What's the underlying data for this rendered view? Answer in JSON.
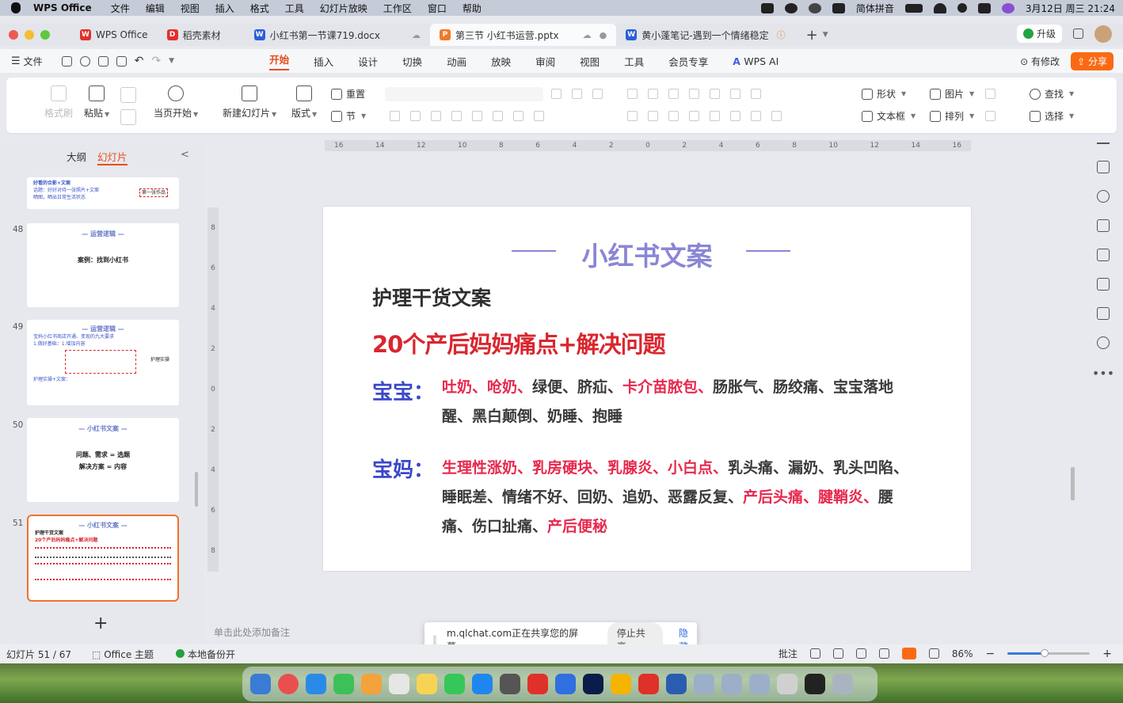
{
  "menubar": {
    "app": "WPS Office",
    "items": [
      "文件",
      "编辑",
      "视图",
      "插入",
      "格式",
      "工具",
      "幻灯片放映",
      "工作区",
      "窗口",
      "帮助"
    ],
    "ime": "简体拼音",
    "datetime": "3月12日 周三 21:24"
  },
  "tabs": [
    {
      "label": "WPS Office",
      "icon_color": "#e0302a",
      "logo": "W"
    },
    {
      "label": "稻壳素材",
      "icon_color": "#e0302a",
      "logo": "D"
    },
    {
      "label": "小红书第一节课719.docx",
      "icon_color": "#2b5fd9",
      "logo": "W"
    },
    {
      "label": "第三节 小红书运营.pptx",
      "icon_color": "#f07a27",
      "logo": "P",
      "active": true
    },
    {
      "label": "黄小蓬笔记-遇到一个情绪稳定",
      "icon_color": "#2b5fd9",
      "logo": "W"
    }
  ],
  "tabbar": {
    "upgrade": "升级"
  },
  "menurow": {
    "file": "文件",
    "tabs": [
      "开始",
      "插入",
      "设计",
      "切换",
      "动画",
      "放映",
      "审阅",
      "视图",
      "工具",
      "会员专享"
    ],
    "active": "开始",
    "ai": "WPS AI",
    "modified": "有修改",
    "share": "分享"
  },
  "ribbon": {
    "format_brush": "格式刷",
    "paste": "粘贴",
    "from_current": "当页开始",
    "new_slide": "新建幻灯片",
    "layout": "版式",
    "reset": "重置",
    "section": "节",
    "shape": "形状",
    "picture": "图片",
    "textbox": "文本框",
    "arrange": "排列",
    "find": "查找",
    "select": "选择"
  },
  "panel": {
    "outline": "大纲",
    "slides": "幻灯片",
    "collapse": "<",
    "add": "+"
  },
  "thumbs": [
    {
      "num": "",
      "title": "好看的合影+文案",
      "lines": [
        "话题：好好对待一张照片+文案",
        "晒图，晒出日常生活状态"
      ],
      "tag": "第一张作品"
    },
    {
      "num": "48",
      "title": "— 运营逻辑 —",
      "body": "案例：找到小红书"
    },
    {
      "num": "49",
      "title": "— 运营逻辑 —",
      "lines": [
        "宝妈小红书商店开通、变现的九大要求",
        "1.做好基础：1.增加内容",
        "护理实操+文案："
      ],
      "tag": "护理实操"
    },
    {
      "num": "50",
      "title": "— 小红书文案 —",
      "body": "问题、需求 = 选题",
      "body2": "解决方案 = 内容"
    },
    {
      "num": "51",
      "title": "— 小红书文案 —",
      "lines": [
        "护理干货文案",
        "20个产后妈妈痛点+解决问题"
      ],
      "selected": true
    }
  ],
  "ruler": {
    "h": [
      "16",
      "14",
      "12",
      "10",
      "8",
      "6",
      "4",
      "2",
      "0",
      "2",
      "4",
      "6",
      "8",
      "10",
      "12",
      "14",
      "16"
    ],
    "v": [
      "8",
      "6",
      "4",
      "2",
      "0",
      "2",
      "4",
      "6",
      "8"
    ]
  },
  "slide": {
    "title": "小红书文案",
    "subtitle": "护理干货文案",
    "headline": "20个产后妈妈痛点+解决问题",
    "baby": {
      "label": "宝宝：",
      "red1": "吐奶、呛奶、",
      "n1": "绿便、脐疝、",
      "red2": "卡介苗脓包、",
      "n2": "肠胀气、肠绞痛、宝宝落地醒、黑白颠倒、奶睡、抱睡"
    },
    "mom": {
      "label": "宝妈：",
      "red1": "生理性涨奶、乳房硬块、乳腺炎、小白点、",
      "n1": "乳头痛、漏奶、乳头凹陷、睡眠差、情绪不好、回奶、追奶、恶露反复、",
      "red2": "产后头痛、腱鞘炎、",
      "n2": "腰痛、伤口扯痛、",
      "red3": "产后便秘"
    }
  },
  "notes": "单击此处添加备注",
  "share_popup": {
    "text": "m.qlchat.com正在共享您的屏幕。",
    "stop": "停止共享",
    "hide": "隐藏"
  },
  "status": {
    "slide_count": "幻灯片 51 / 67",
    "theme": "Office 主题",
    "backup": "本地备份开",
    "comments": "批注",
    "zoom": "86%",
    "zoom_level": 0.45
  },
  "colors": {
    "accent": "#e84c1d",
    "share": "#fa6a14",
    "title": "#8a86d4",
    "red": "#d9262e",
    "pink": "#e8284d",
    "blue": "#3a48c8"
  },
  "dock_colors": [
    "#3a7bd5",
    "#e94f4f",
    "#2b8ae8",
    "#3cc15a",
    "#f3a23c",
    "#e6e6e6",
    "#f7d354",
    "#35c759",
    "#1f86f0",
    "#555555",
    "#e0302a",
    "#2f6fe0",
    "#0a1d4a",
    "#f4b400",
    "#e0302a",
    "#2a5db0",
    "#9bb0c8",
    "#9bb0c8",
    "#9bb0c8",
    "#d0d0d0",
    "#222222",
    "#aab4c0"
  ]
}
